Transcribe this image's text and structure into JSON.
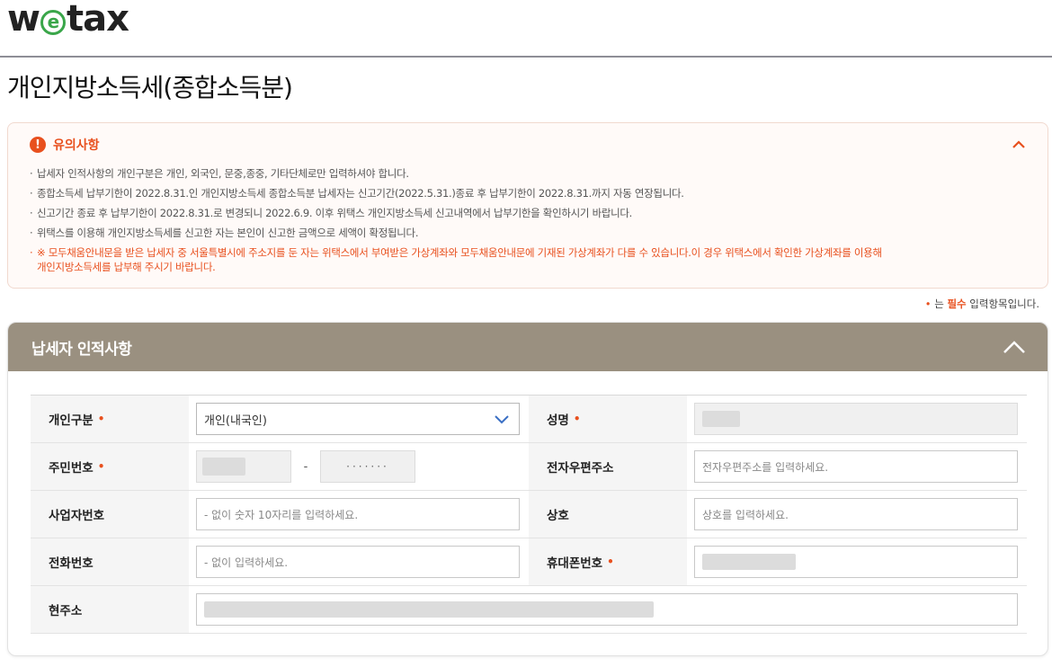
{
  "header": {
    "logo_w": "w",
    "logo_e": "e",
    "logo_rest": "tax"
  },
  "page": {
    "title": "개인지방소득세(종합소득분)"
  },
  "notice": {
    "title": "유의사항",
    "icon": "!",
    "items": [
      "납세자 인적사항의 개인구분은 개인, 외국인, 문중,종중, 기타단체로만 입력하셔야 합니다.",
      "종합소득세 납부기한이 2022.8.31.인 개인지방소득세 종합소득분 납세자는 신고기간(2022.5.31.)종료 후 납부기한이 2022.8.31.까지 자동 연장됩니다.",
      "신고기간 종료 후 납부기한이 2022.8.31.로 변경되니 2022.6.9. 이후 위택스 개인지방소득세 신고내역에서 납부기한을 확인하시기 바랍니다.",
      "위택스를 이용해 개인지방소득세를 신고한 자는 본인이 신고한 금액으로 세액이 확정됩니다."
    ],
    "warning_line1": "※ 모두채움안내문을 받은 납세자 중 서울특별시에 주소지를 둔 자는 위택스에서 부여받은 가상계좌와 모두채움안내문에 기재된 가상계좌가 다를 수 있습니다.이 경우 위택스에서 확인한 가상계좌를 이용해",
    "warning_line2": "개인지방소득세를 납부해 주시기 바랍니다."
  },
  "required_note": {
    "dot": "•",
    "text1": " 는 ",
    "strong": "필수",
    "text2": " 입력항목입니다."
  },
  "panel": {
    "title": "납세자 인적사항",
    "required_mark": "•",
    "fields": {
      "type_label": "개인구분",
      "type_value": "개인(내국인)",
      "name_label": "성명",
      "rrn_label": "주민번호",
      "rrn_dash": "-",
      "rrn_masked": "·······",
      "email_label": "전자우편주소",
      "email_placeholder": "전자우편주소를 입력하세요.",
      "biz_label": "사업자번호",
      "biz_placeholder": "- 없이 숫자 10자리를 입력하세요.",
      "company_label": "상호",
      "company_placeholder": "상호를 입력하세요.",
      "phone_label": "전화번호",
      "phone_placeholder": "- 없이 입력하세요.",
      "mobile_label": "휴대폰번호",
      "address_label": "현주소"
    }
  },
  "colors": {
    "accent": "#e8501e",
    "panel_header": "#9a9080",
    "logo_green": "#3aa64a"
  }
}
